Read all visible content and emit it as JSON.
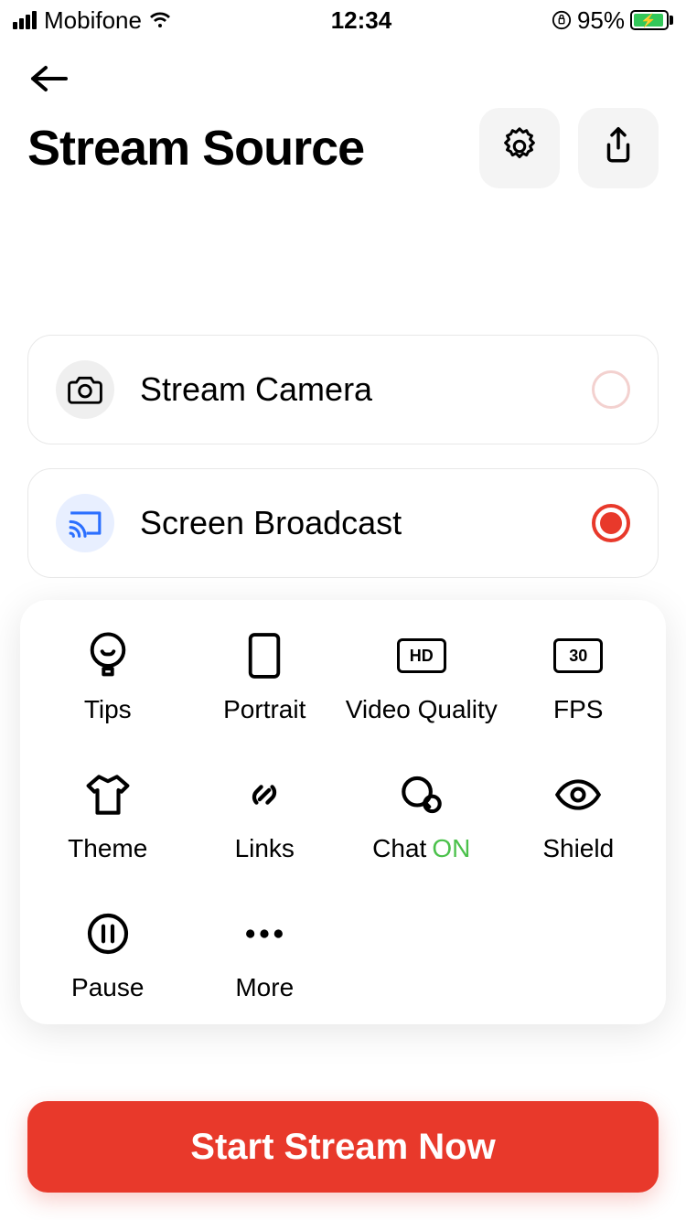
{
  "statusbar": {
    "carrier": "Mobifone",
    "time": "12:34",
    "battery_pct": "95%"
  },
  "header": {
    "title": "Stream Source"
  },
  "sources": {
    "camera": {
      "label": "Stream Camera"
    },
    "broadcast": {
      "label": "Screen Broadcast"
    }
  },
  "panel": {
    "tips": "Tips",
    "portrait": "Portrait",
    "video_quality": "Video Quality",
    "video_quality_badge": "HD",
    "fps": "FPS",
    "fps_badge": "30",
    "theme": "Theme",
    "links": "Links",
    "chat": "Chat",
    "chat_state": "ON",
    "shield": "Shield",
    "pause": "Pause",
    "more": "More"
  },
  "cta": {
    "label": "Start Stream Now"
  }
}
